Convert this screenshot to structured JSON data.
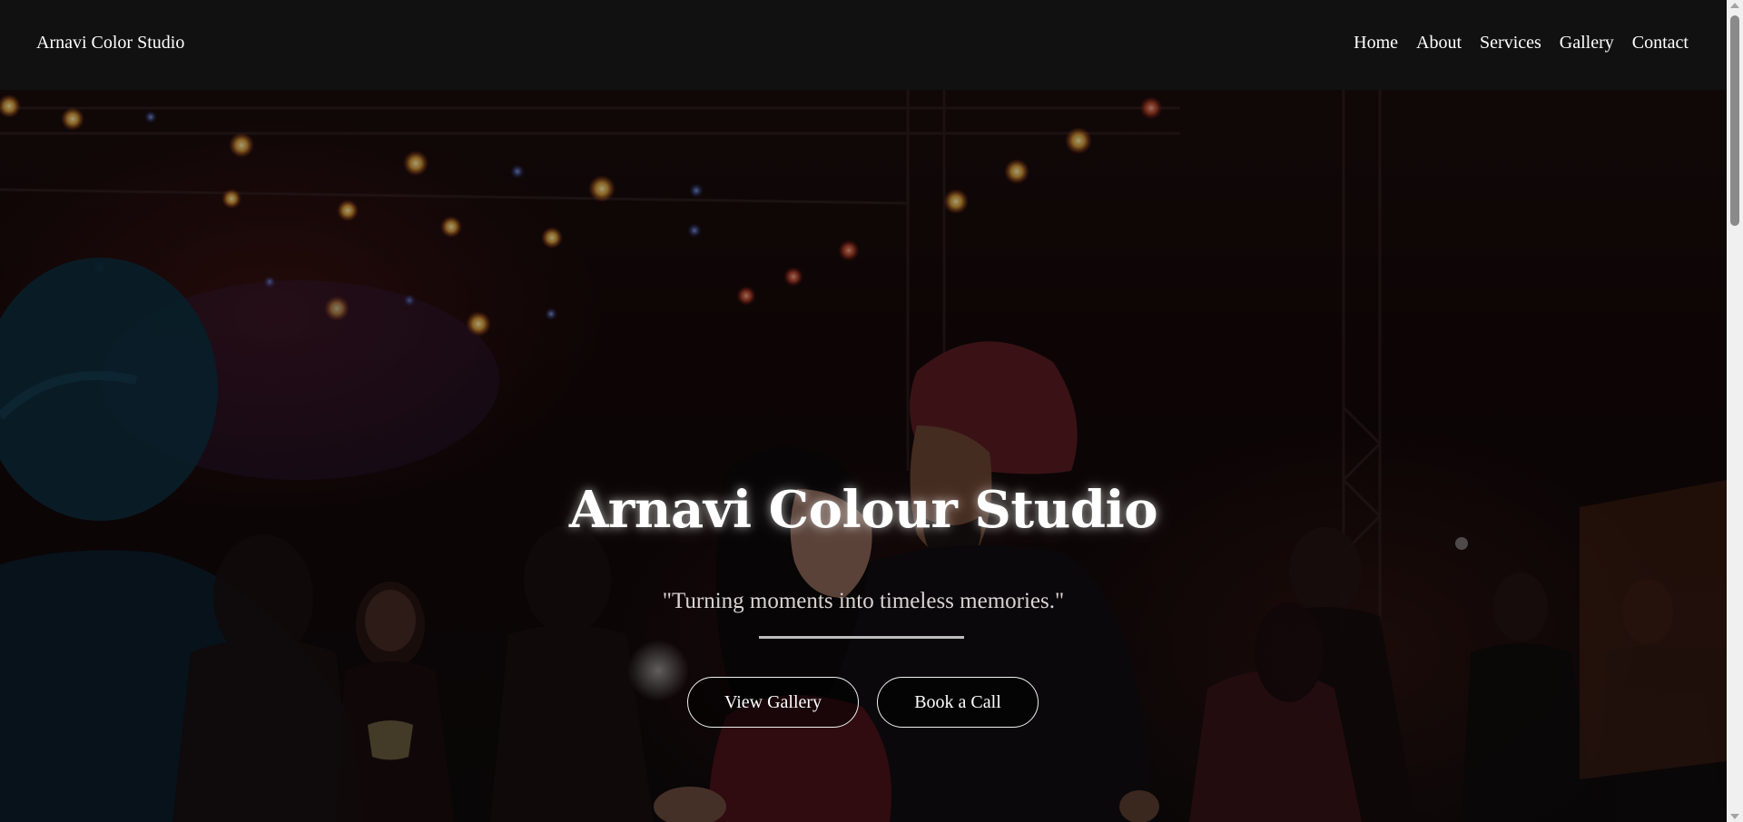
{
  "navbar": {
    "brand": "Arnavi Color Studio",
    "links": [
      "Home",
      "About",
      "Services",
      "Gallery",
      "Contact"
    ]
  },
  "hero": {
    "title": "Arnavi Colour Studio",
    "subtitle": "\"Turning moments into timeless memories.\"",
    "buttons": {
      "gallery": "View Gallery",
      "call": "Book a Call"
    },
    "image_description_icon": "wedding-dance-photo"
  },
  "colors": {
    "navbar_bg": "#111111",
    "text": "#ffffff",
    "subtitle": "#d9d4d4",
    "divider": "#bdbdbd"
  }
}
